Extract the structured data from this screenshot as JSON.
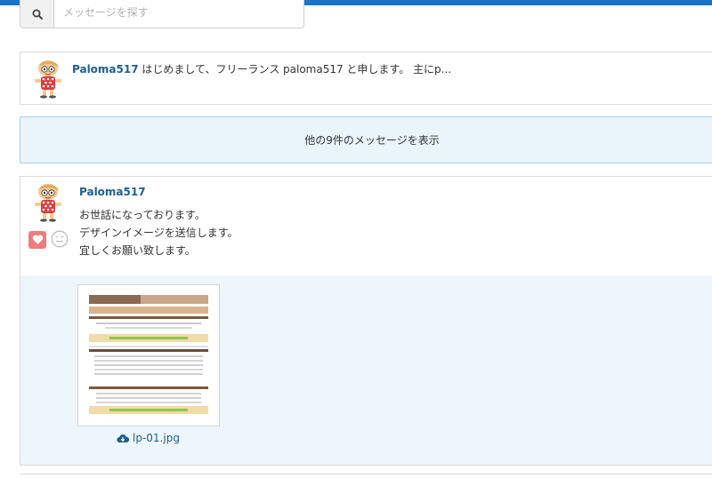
{
  "search": {
    "placeholder": "メッセージを探す"
  },
  "messages": [
    {
      "username": "Paloma517",
      "preview": "はじめまして、フリーランス paloma517 と申します。 主にp..."
    }
  ],
  "more_button": {
    "label": "他の9件のメッセージを表示"
  },
  "latest": {
    "username": "Paloma517",
    "lines": [
      "お世話になっております。",
      "デザインイメージを送信します。",
      "宜しくお願い致します。"
    ],
    "attachment": {
      "filename": "lp-01.jpg"
    }
  },
  "icons": [
    "search-icon",
    "heart-reaction-icon",
    "neutral-face-reaction-icon",
    "cloud-download-icon"
  ],
  "colors": {
    "accent": "#1a73c4",
    "username": "#1f5f8e",
    "more_bg": "#eaf5fb",
    "attach_bg": "#edf6fb"
  }
}
